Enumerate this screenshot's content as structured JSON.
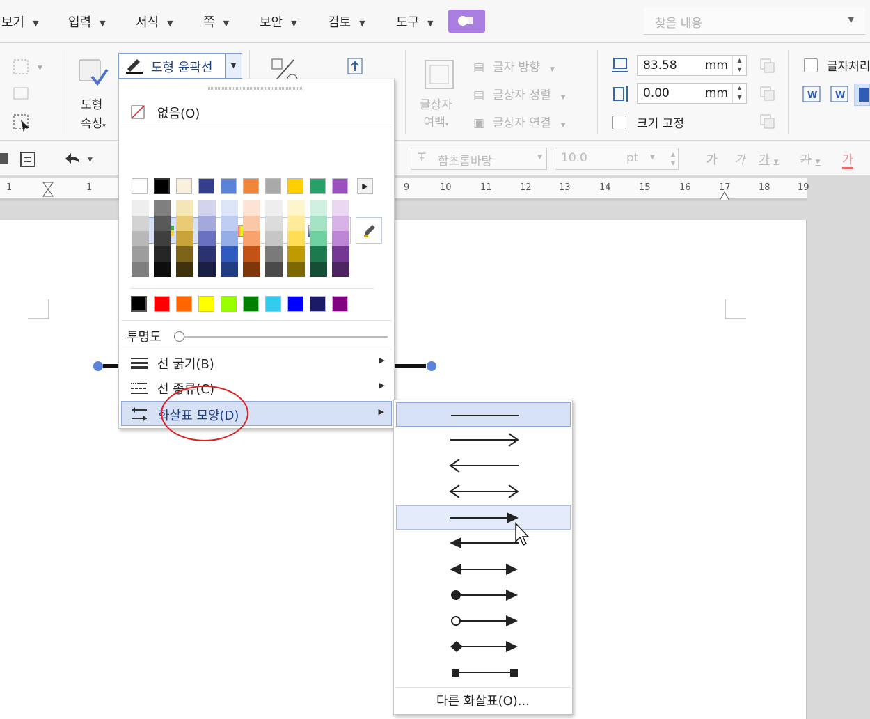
{
  "menubar": {
    "items": [
      {
        "label": "보기"
      },
      {
        "label": "입력"
      },
      {
        "label": "서식"
      },
      {
        "label": "쪽"
      },
      {
        "label": "보안"
      },
      {
        "label": "검토"
      },
      {
        "label": "도구"
      }
    ],
    "search_placeholder": "찾을 내용"
  },
  "ribbon": {
    "shape_props_line1": "도형",
    "shape_props_line2": "속성",
    "outline_label": "도형 윤곽선",
    "textbox_margin_line1": "글상자",
    "textbox_margin_line2": "여백",
    "text_direction": "글자 방향",
    "textbox_align": "글상자 정렬",
    "textbox_link": "글상자 연결",
    "height_value": "83.58",
    "width_value": "0.00",
    "unit": "mm",
    "size_fixed": "크기 고정",
    "text_wrap": "글자처리"
  },
  "toolbar": {
    "font_name": "함초롬바탕",
    "font_size": "10.0",
    "size_unit": "pt",
    "style_glyph": "가"
  },
  "ruler": {
    "numbers": [
      "1",
      "1",
      "9",
      "10",
      "11",
      "12",
      "13",
      "14",
      "15",
      "16",
      "17",
      "18",
      "19"
    ]
  },
  "dropdown": {
    "none_label": "없음(O)",
    "transparency_label": "투명도",
    "line_thickness": "선 굵기(B)",
    "line_type": "선 종류(C)",
    "arrow_shape": "화살표 모양(D)",
    "colors_row1": [
      "#ffffff",
      "#000000",
      "#f8f0dc",
      "#333f8c",
      "#5b84d8",
      "#f2853c",
      "#a9a9a9",
      "#ffcf00",
      "#27a06a",
      "#9a4fbf"
    ],
    "color_columns": [
      [
        "#eeeeee",
        "#d3d3d3",
        "#b8b8b8",
        "#9d9d9d",
        "#7f7f7f"
      ],
      [
        "#7f7f7f",
        "#595959",
        "#3f3f3f",
        "#262626",
        "#0d0d0d"
      ],
      [
        "#f5e6b8",
        "#e9cb76",
        "#c9a43a",
        "#7d6418",
        "#3f320c"
      ],
      [
        "#d2d4ee",
        "#a4a8dc",
        "#6a71c0",
        "#2b326f",
        "#1a1e44"
      ],
      [
        "#dde6f8",
        "#bccdf1",
        "#93afe6",
        "#2f5bc0",
        "#1f3d80"
      ],
      [
        "#fde3d3",
        "#fbc8a7",
        "#f8a36d",
        "#c25314",
        "#7f3609"
      ],
      [
        "#eeeeee",
        "#dcdcdc",
        "#c6c6c6",
        "#7a7a7a",
        "#4a4a4a"
      ],
      [
        "#fff5cc",
        "#ffeb99",
        "#ffde55",
        "#bf9b00",
        "#7f6700"
      ],
      [
        "#d0f0e0",
        "#a3e2c2",
        "#6fd0a0",
        "#1d7a4f",
        "#144f35"
      ],
      [
        "#ead8f2",
        "#d6b2e6",
        "#bd86d6",
        "#743894",
        "#4d2562"
      ]
    ],
    "colors_standard": [
      "#000000",
      "#ff0000",
      "#ff6600",
      "#ffff00",
      "#99ff00",
      "#008000",
      "#33ccee",
      "#0000ff",
      "#1a1a66",
      "#800080"
    ]
  },
  "submenu": {
    "arrow_styles": [
      "line",
      "arrow-end",
      "arrow-start",
      "arrow-both",
      "filled-arrow-end",
      "filled-arrow-start",
      "filled-arrow-both",
      "circle-arrow",
      "open-circle-arrow",
      "diamond-arrow",
      "square-both"
    ],
    "other_arrows": "다른 화살표(O)..."
  },
  "colors": {
    "accent": "#a97ee0",
    "highlight": "#d7e1f6",
    "annotation": "#e02020",
    "handle": "#5b84d8"
  }
}
